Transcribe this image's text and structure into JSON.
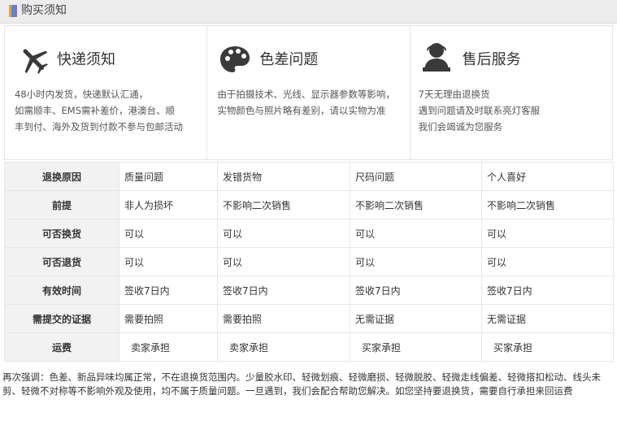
{
  "header": {
    "title": "购买须知",
    "bar_colors": [
      "#f0a030",
      "#4a8fd8",
      "#8a6fc0"
    ]
  },
  "cards": [
    {
      "icon": "airplane-icon",
      "title": "快递须知",
      "lines": [
        "48小时内发货，快递默认汇通，",
        "如需顺丰、EMS需补差价，港澳台、顺",
        "丰到付、海外及货到付款不参与包邮活动"
      ]
    },
    {
      "icon": "palette-icon",
      "title": "色差问题",
      "lines": [
        "由于拍摄技术、光线、显示器参数等影响，",
        "实物颜色与照片略有差别，请以实物为准"
      ]
    },
    {
      "icon": "customer-service-icon",
      "title": "售后服务",
      "lines": [
        "7天无理由退换货",
        "遇到问题请及时联系亮灯客服",
        "我们会竭诚为您服务"
      ]
    }
  ],
  "table": {
    "rows": [
      {
        "label": "退换原因",
        "cells": [
          "质量问题",
          "发错货物",
          "尺码问题",
          "个人喜好"
        ]
      },
      {
        "label": "前提",
        "cells": [
          "非人为损坏",
          "不影响二次销售",
          "不影响二次销售",
          "不影响二次销售"
        ]
      },
      {
        "label": "可否换货",
        "cells": [
          "可以",
          "可以",
          "可以",
          "可以"
        ]
      },
      {
        "label": "可否退货",
        "cells": [
          "可以",
          "可以",
          "可以",
          "可以"
        ]
      },
      {
        "label": "有效时间",
        "cells": [
          "签收7日内",
          "签收7日内",
          "签收7日内",
          "签收7日内"
        ]
      },
      {
        "label": "需提交的证据",
        "cells": [
          "需要拍照",
          "需要拍照",
          "无需证据",
          "无需证据"
        ]
      },
      {
        "label": "运费",
        "cells": [
          "卖家承担",
          "卖家承担",
          "买家承担",
          "买家承担"
        ]
      }
    ]
  },
  "note": "再次强调：色差、新品异味均属正常，不在退换货范围内。少量胶水印、轻微划痕、轻微磨损、轻微脱胶、轻微走线偏差、轻微搭扣松动、线头未剪、轻微不对称等不影响外观及使用，均不属于质量问题。一旦遇到，我们会配合帮助您解决。如您坚持要退换货，需要自行承担来回运费"
}
